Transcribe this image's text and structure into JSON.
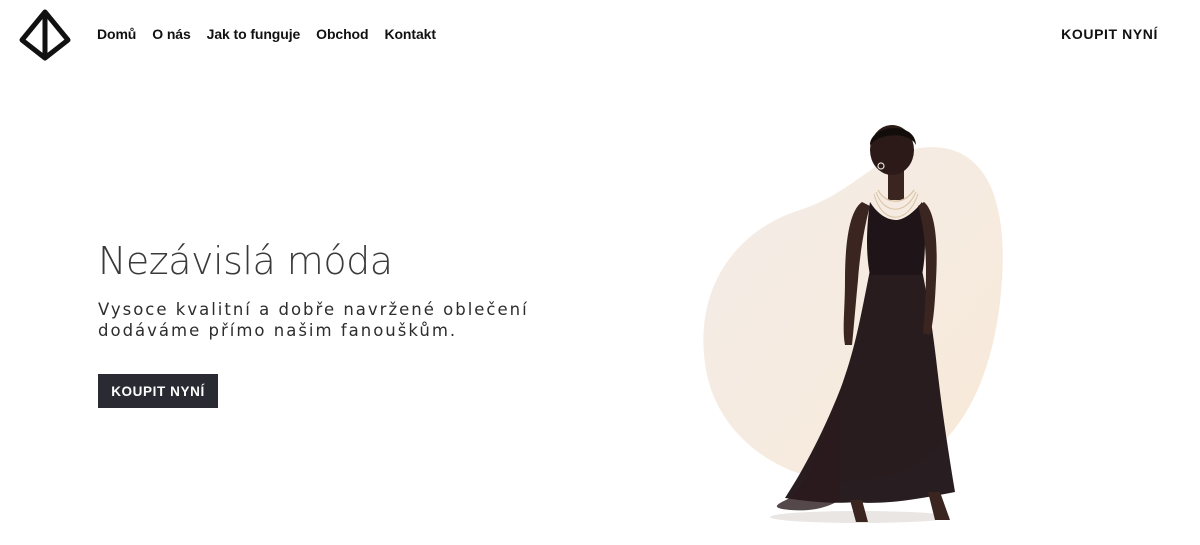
{
  "header": {
    "logo_icon": "diamond-logo-icon",
    "nav": [
      {
        "label": "Domů"
      },
      {
        "label": "O nás"
      },
      {
        "label": "Jak to funguje"
      },
      {
        "label": "Obchod"
      },
      {
        "label": "Kontakt"
      }
    ],
    "cta_label": "KOUPIT NYNÍ"
  },
  "hero": {
    "title": "Nezávislá móda",
    "subtitle_line1": "Vysoce kvalitní a dobře navržené oblečení",
    "subtitle_line2": "dodáváme přímo našim fanouškům.",
    "button_label": "KOUPIT NYNÍ",
    "image": "model-in-black-dress",
    "blob_color": "#f7ebdd",
    "button_color": "#2a2a33"
  }
}
